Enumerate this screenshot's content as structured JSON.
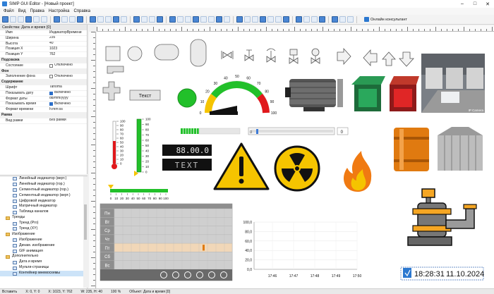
{
  "window": {
    "title": "SIMP GUI Editor - [Новый проект]"
  },
  "menu": [
    "Файл",
    "Вид",
    "Правка",
    "Настройка",
    "Справка"
  ],
  "toolbar": {
    "online_label": "Онлайн консультант"
  },
  "props": {
    "header": "Свойства: Дата и время [0]",
    "rows": [
      {
        "k": "Имя",
        "v": "ИндикаторВремени"
      },
      {
        "k": "Ширина",
        "v": "235"
      },
      {
        "k": "Высота",
        "v": "40"
      },
      {
        "k": "Позиция X",
        "v": "1023"
      },
      {
        "k": "Позиция Y",
        "v": "762"
      },
      {
        "k": "Подсказка",
        "sec": true
      },
      {
        "k": "Состояние",
        "v": "Отключено",
        "cb": false
      },
      {
        "k": "Фон",
        "sec": true
      },
      {
        "k": "Заполнение фона",
        "v": "Отключено",
        "cb": false
      },
      {
        "k": "Содержание",
        "sec": true
      },
      {
        "k": "Шрифт",
        "v": "Tahoma"
      },
      {
        "k": "Показывать дату",
        "v": "Включено",
        "cb": true
      },
      {
        "k": "Формат даты",
        "v": "dd/mm/yyyy"
      },
      {
        "k": "Показывать время",
        "v": "Включено",
        "cb": true
      },
      {
        "k": "Формат времени",
        "v": "h:mm:ss"
      },
      {
        "k": "Рамка",
        "sec": true
      },
      {
        "k": "Вид рамки",
        "v": "Без рамки"
      }
    ]
  },
  "tree": [
    {
      "label": "Линейный индикатор (верт.)",
      "lvl": 2
    },
    {
      "label": "Линейный индикатор (гор.)",
      "lvl": 2
    },
    {
      "label": "Сегментный индикатор (гор.)",
      "lvl": 2
    },
    {
      "label": "Сегментный индикатор (верт.)",
      "lvl": 2
    },
    {
      "label": "Цифровой индикатор",
      "lvl": 2
    },
    {
      "label": "Матричный индикатор",
      "lvl": 2
    },
    {
      "label": "Таблица каналов",
      "lvl": 2
    },
    {
      "label": "Тренды",
      "lvl": 1,
      "fold": true
    },
    {
      "label": "Тренд (Pro)",
      "lvl": 2
    },
    {
      "label": "Тренд (XY)",
      "lvl": 2
    },
    {
      "label": "Изображение",
      "lvl": 1,
      "fold": true
    },
    {
      "label": "Изображение",
      "lvl": 2
    },
    {
      "label": "Динам. изображение",
      "lvl": 2
    },
    {
      "label": "GIF анимация",
      "lvl": 2
    },
    {
      "label": "Дополнительно",
      "lvl": 1,
      "fold": true
    },
    {
      "label": "Дата и время",
      "lvl": 2
    },
    {
      "label": "Мульти-страницы",
      "lvl": 2
    },
    {
      "label": "Контейнер мнемосхемы",
      "lvl": 2,
      "sel": true
    }
  ],
  "status": {
    "ready": "Вставить",
    "pos": "X: 0, Y: 0",
    "obj_pos": "X: 1023, Y: 762",
    "obj_size": "W: 235, H: 40",
    "zoom": "100 %",
    "object": "Объект: Дата и время [0]"
  },
  "canvas": {
    "text_button": "Текст",
    "gauge_ticks": [
      "0",
      "10",
      "20",
      "30",
      "40",
      "50",
      "60",
      "70",
      "80",
      "90",
      "100"
    ],
    "vbar_ticks": [
      "100",
      "90",
      "80",
      "70",
      "60",
      "50",
      "40",
      "30",
      "20",
      "10",
      "0"
    ],
    "hbar_ticks": [
      "0",
      "10",
      "20",
      "30",
      "40",
      "50",
      "60",
      "70",
      "80",
      "90",
      "100"
    ],
    "slider_value": "0",
    "seg1": "88.00.0",
    "seg2": "TEXT",
    "camera_label": "IP Camera",
    "days": [
      "Пн",
      "Вт",
      "Ср",
      "Чт",
      "Пт",
      "Сб",
      "Вс"
    ],
    "trend_y": [
      "100,0",
      "80,0",
      "60,0",
      "40,0",
      "20,0",
      "0,0"
    ],
    "trend_x": [
      "17:46",
      "17:47",
      "17:48",
      "17:49",
      "17:50"
    ],
    "clock_time": "18:28:31",
    "clock_date": "11.10.2024",
    "colors": {
      "green": "#22c02a",
      "yellow": "#f5c400",
      "red": "#e0181c",
      "orange": "#e07a10",
      "blue": "#3d7ad6"
    }
  }
}
